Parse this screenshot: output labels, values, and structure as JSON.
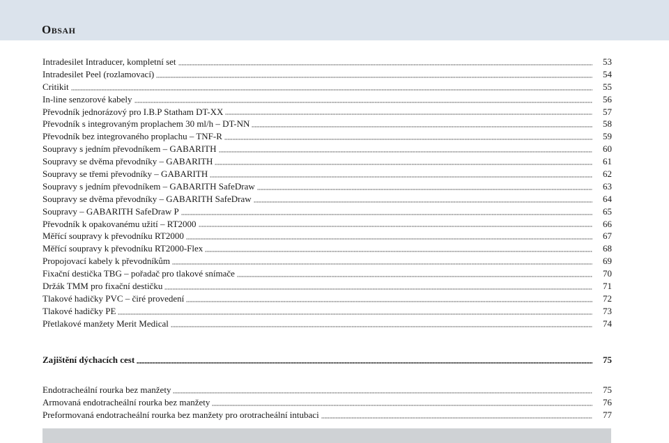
{
  "header": {
    "title": "Obsah"
  },
  "toc_main": [
    {
      "label": "Intradesilet Intraducer, kompletní set",
      "page": "53"
    },
    {
      "label": "Intradesilet Peel (rozlamovací)",
      "page": "54"
    },
    {
      "label": "Critikit",
      "page": "55"
    },
    {
      "label": "In-line senzorové kabely",
      "page": "56"
    },
    {
      "label": "Převodník jednorázový pro I.B.P Statham DT-XX",
      "page": "57"
    },
    {
      "label": "Převodník s integrovaným proplachem 30 ml/h – DT-NN",
      "page": "58"
    },
    {
      "label": "Převodník bez integrovaného proplachu – TNF-R",
      "page": "59"
    },
    {
      "label": "Soupravy s jedním převodníkem – GABARITH",
      "page": "60"
    },
    {
      "label": "Soupravy se dvěma převodníky – GABARITH",
      "page": "61"
    },
    {
      "label": "Soupravy se třemi převodníky – GABARITH",
      "page": "62"
    },
    {
      "label": "Soupravy s jedním převodníkem – GABARITH SafeDraw",
      "page": "63"
    },
    {
      "label": "Soupravy se dvěma převodníky – GABARITH SafeDraw",
      "page": "64"
    },
    {
      "label": "Soupravy – GABARITH SafeDraw P",
      "page": "65"
    },
    {
      "label": "Převodník k opakovanému užití – RT2000",
      "page": "66"
    },
    {
      "label": "Měřící soupravy k převodníku RT2000",
      "page": "67"
    },
    {
      "label": "Měřící soupravy k převodníku RT2000-Flex",
      "page": "68"
    },
    {
      "label": "Propojovací kabely k převodníkům",
      "page": "69"
    },
    {
      "label": "Fixační destička TBG – pořadač pro tlakové snímače",
      "page": "70"
    },
    {
      "label": "Držák TMM pro fixační destičku",
      "page": "71"
    },
    {
      "label": "Tlakové hadičky PVC – čiré provedení",
      "page": "72"
    },
    {
      "label": "Tlakové hadičky PE",
      "page": "73"
    },
    {
      "label": "Přetlakové manžety Merit Medical",
      "page": "74"
    }
  ],
  "section2": {
    "heading": {
      "label": "Zajištění dýchacích cest",
      "page": "75"
    },
    "items": [
      {
        "label": "Endotracheální rourka bez manžety",
        "page": "75"
      },
      {
        "label": "Armovaná endotracheální rourka bez manžety",
        "page": "76"
      },
      {
        "label": "Preformovaná endotracheální rourka bez manžety pro orotracheální intubaci",
        "page": "77"
      }
    ]
  }
}
